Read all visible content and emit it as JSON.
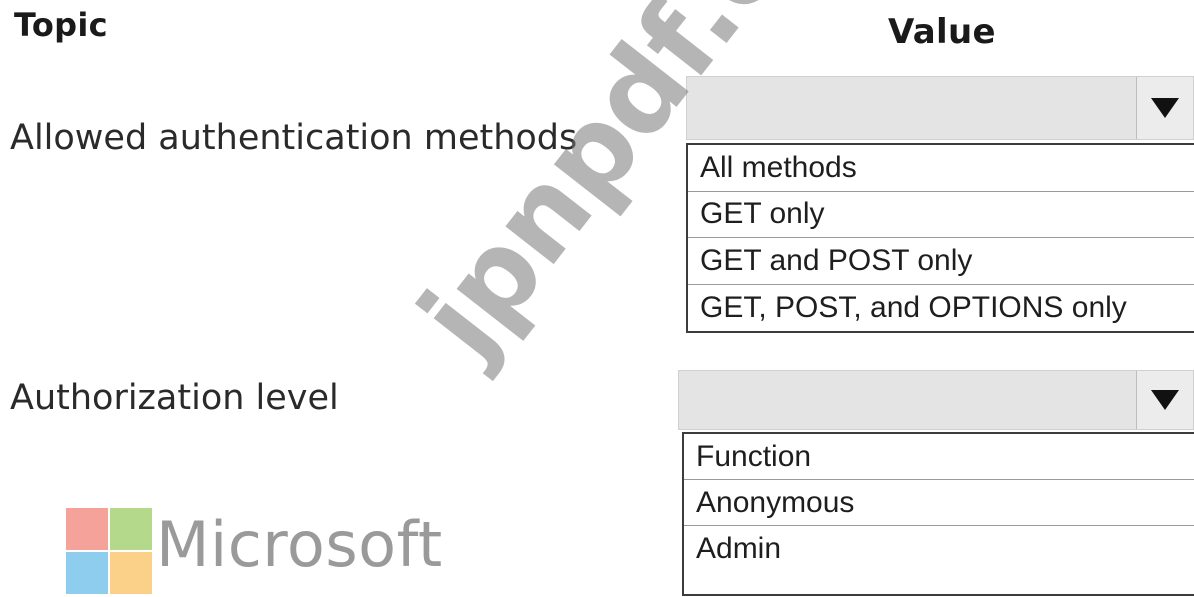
{
  "headers": {
    "topic": "Topic",
    "value": "Value"
  },
  "rows": [
    {
      "label": "Allowed authentication methods",
      "selected_value": "",
      "options": [
        "All methods",
        "GET only",
        "GET and POST only",
        "GET, POST, and OPTIONS only"
      ]
    },
    {
      "label": "Authorization level",
      "selected_value": "",
      "options": [
        "Function",
        "Anonymous",
        "Admin"
      ]
    }
  ],
  "icons": {
    "dropdown": "dropdown-arrow-icon",
    "logo": "microsoft-logo-icon"
  },
  "logo": {
    "text": "Microsoft",
    "colors": [
      "#f25022",
      "#7fba00",
      "#00a4ef",
      "#ffb900"
    ]
  },
  "watermark": {
    "text": "jpnpdf.com"
  }
}
